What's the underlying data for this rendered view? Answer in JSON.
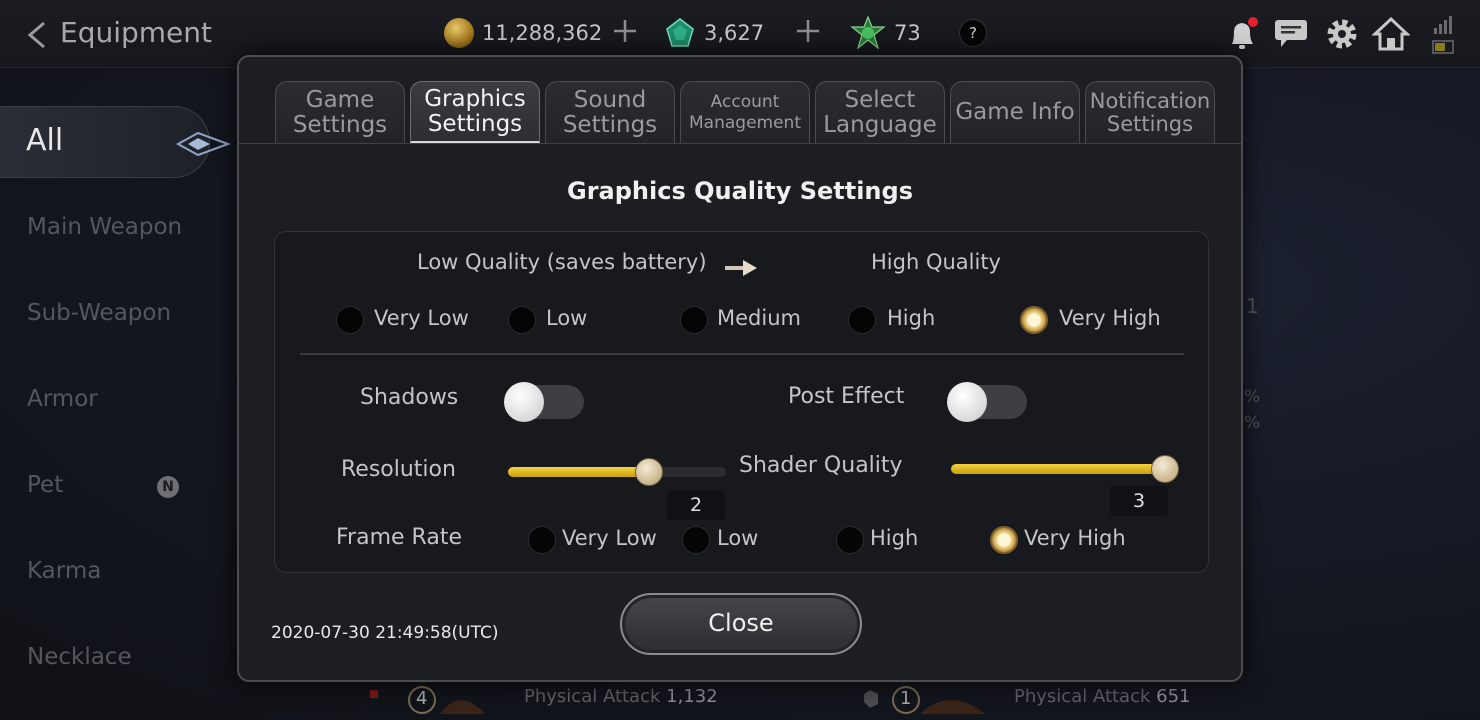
{
  "header": {
    "title": "Equipment",
    "gold": "11,288,362",
    "gems": "3,627",
    "energy": "73",
    "help_label": "?"
  },
  "sidebar": {
    "items": [
      {
        "label": "All"
      },
      {
        "label": "Main Weapon"
      },
      {
        "label": "Sub-Weapon"
      },
      {
        "label": "Armor"
      },
      {
        "label": "Pet",
        "badge": "N"
      },
      {
        "label": "Karma"
      },
      {
        "label": "Necklace"
      }
    ]
  },
  "background_fragments": {
    "right_1": "1",
    "right_2": "%",
    "right_3": "%",
    "level_1": "4",
    "level_2": "1",
    "stat_label": "Physical Attack",
    "stat_1": "1,132",
    "stat_2": "651"
  },
  "modal": {
    "tabs": [
      {
        "label_line1": "Game",
        "label_line2": "Settings",
        "active": false
      },
      {
        "label_line1": "Graphics",
        "label_line2": "Settings",
        "active": true
      },
      {
        "label_line1": "Sound",
        "label_line2": "Settings",
        "active": false
      },
      {
        "label_line1": "Account",
        "label_line2": "Management",
        "active": false
      },
      {
        "label_line1": "Select",
        "label_line2": "Language",
        "active": false
      },
      {
        "label_line1": "Game Info",
        "label_line2": "",
        "active": false
      },
      {
        "label_line1": "Notification",
        "label_line2": "Settings",
        "active": false
      }
    ],
    "panel_title": "Graphics Quality Settings",
    "quality_low_label": "Low Quality (saves battery)",
    "quality_high_label": "High Quality",
    "quality_options": [
      "Very Low",
      "Low",
      "Medium",
      "High",
      "Very High"
    ],
    "quality_selected": "Very High",
    "shadows_label": "Shadows",
    "shadows_on": false,
    "post_effect_label": "Post Effect",
    "post_effect_on": false,
    "resolution_label": "Resolution",
    "resolution_value": "2",
    "resolution_level": 2,
    "resolution_max": 3,
    "shader_label": "Shader Quality",
    "shader_value": "3",
    "shader_level": 3,
    "shader_max": 3,
    "frame_rate_label": "Frame Rate",
    "frame_rate_options": [
      "Very Low",
      "Low",
      "High",
      "Very High"
    ],
    "frame_rate_selected": "Very High",
    "timestamp": "2020-07-30 21:49:58(UTC)",
    "close_label": "Close"
  },
  "colors": {
    "accent_gold": "#e9c33a",
    "panel_bg": "#1c1e22",
    "notification_dot": "#e5202a"
  }
}
